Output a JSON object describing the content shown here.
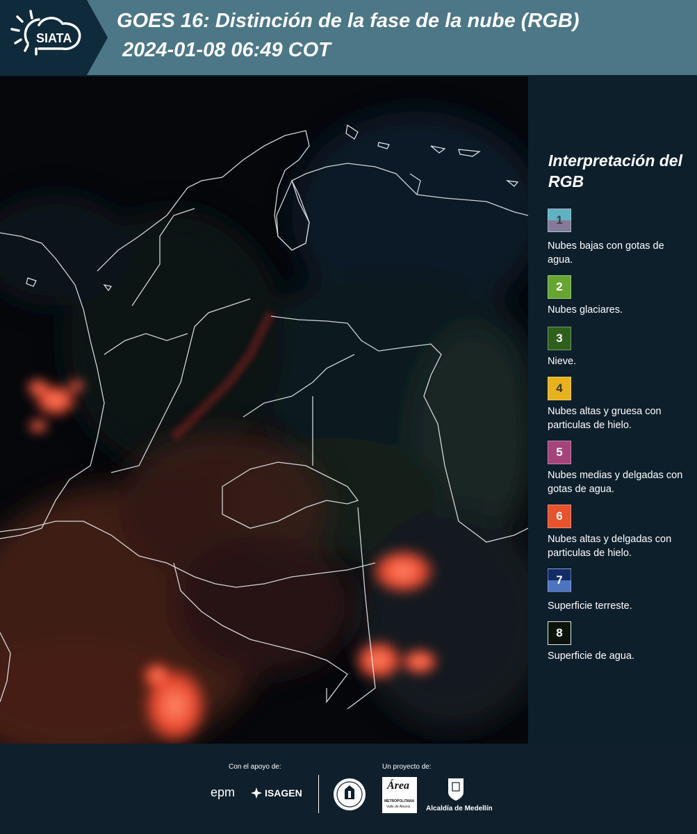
{
  "header": {
    "logo_text": "SIATA",
    "title_line1": "GOES 16: Distinción de la fase de la nube (RGB)",
    "title_line2": "2024-01-08 06:49 COT"
  },
  "legend": {
    "title": "Interpretación del RGB",
    "items": [
      {
        "number": "1",
        "label": "Nubes bajas con gotas de agua.",
        "colors": [
          "#5fb2c4",
          "#857a97"
        ]
      },
      {
        "number": "2",
        "label": "Nubes glaciares.",
        "colors": [
          "#67a532"
        ]
      },
      {
        "number": "3",
        "label": "Nieve.",
        "colors": [
          "#2f5f1c"
        ]
      },
      {
        "number": "4",
        "label": "Nubes altas y gruesa con particulas de hielo.",
        "colors": [
          "#e7b21b"
        ]
      },
      {
        "number": "5",
        "label": "Nubes medias y delgadas con gotas de agua.",
        "colors": [
          "#a5447a"
        ]
      },
      {
        "number": "6",
        "label": "Nubes altas y delgadas con particulas de hielo.",
        "colors": [
          "#e8522c"
        ]
      },
      {
        "number": "7",
        "label": "Superficie terreste.",
        "colors": [
          "#142c66",
          "#4c74c0"
        ]
      },
      {
        "number": "8",
        "label": "Superficie de agua.",
        "colors": [
          "#0a140b"
        ]
      }
    ]
  },
  "footer": {
    "support_label": "Con el apoyo de:",
    "project_label": "Un proyecto de:",
    "epm": "epm",
    "isagen": "ISAGEN",
    "area_logo": "Área",
    "area_sub1": "METROPOLITANA",
    "area_sub2": "Valle de Aburrá",
    "alcaldia": "Alcaldía de Medellín"
  }
}
